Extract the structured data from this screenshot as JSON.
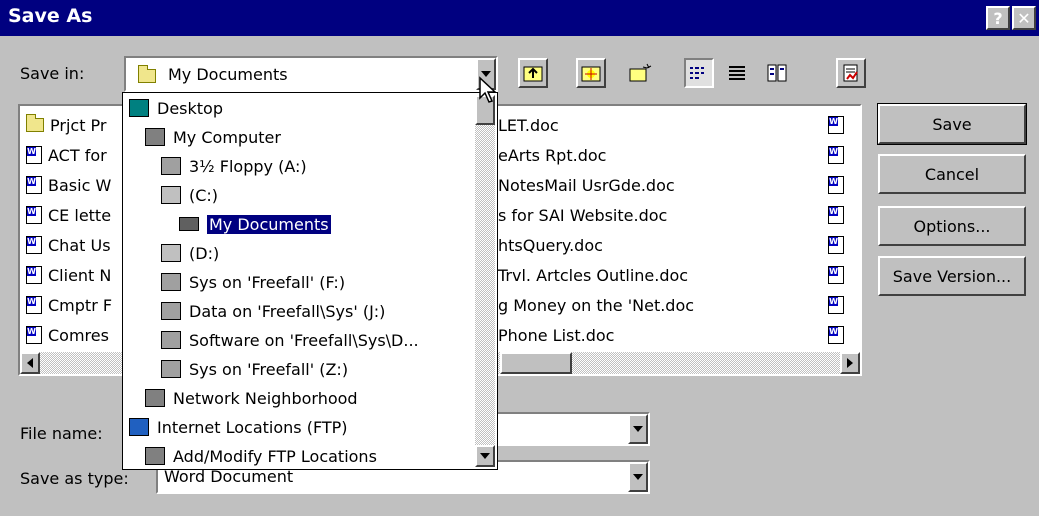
{
  "window": {
    "title": "Save As",
    "help_label": "?",
    "close_label": "✕"
  },
  "save_in": {
    "label": "Save in:",
    "value": "My Documents"
  },
  "toolbar": {
    "icons": [
      "up-one-level-icon",
      "search-web-icon",
      "create-new-folder-icon",
      "list-view-icon",
      "details-view-icon",
      "properties-view-icon",
      "tools-icon"
    ]
  },
  "dropdown": {
    "items": [
      {
        "label": "Desktop",
        "icon": "desktop-icon"
      },
      {
        "label": "My Computer",
        "icon": "computer-icon"
      },
      {
        "label": "3½ Floppy (A:)",
        "icon": "floppy-icon"
      },
      {
        "label": "(C:)",
        "icon": "hard-drive-icon"
      },
      {
        "label": "My Documents",
        "icon": "folder-icon",
        "selected": true
      },
      {
        "label": "(D:)",
        "icon": "cd-drive-icon"
      },
      {
        "label": "Sys on 'Freefall' (F:)",
        "icon": "network-drive-icon"
      },
      {
        "label": "Data on 'Freefall\\Sys' (J:)",
        "icon": "network-drive-icon"
      },
      {
        "label": "Software on 'Freefall\\Sys\\D...",
        "icon": "network-drive-icon"
      },
      {
        "label": "Sys on 'Freefall' (Z:)",
        "icon": "network-drive-icon"
      },
      {
        "label": "Network Neighborhood",
        "icon": "network-neighborhood-icon"
      },
      {
        "label": "Internet Locations (FTP)",
        "icon": "internet-icon"
      },
      {
        "label": "Add/Modify FTP Locations",
        "icon": "ftp-icon"
      }
    ]
  },
  "files_left": [
    "Prjct Pr",
    "ACT for",
    "Basic W",
    "CE lette",
    "Chat Us",
    "Client N",
    "Cmptr F",
    "Comres"
  ],
  "files_right": [
    "LET.doc",
    "eArts Rpt.doc",
    "NotesMail UsrGde.doc",
    "s for SAI Website.doc",
    "htsQuery.doc",
    "Trvl. Artcles Outline.doc",
    "g Money on the 'Net.doc",
    "Phone List.doc"
  ],
  "file_name": {
    "label": "File name:",
    "value": ""
  },
  "save_as_type": {
    "label": "Save as type:",
    "value": "Word Document"
  },
  "buttons": {
    "save": "Save",
    "cancel": "Cancel",
    "options": "Options...",
    "save_version": "Save Version..."
  }
}
